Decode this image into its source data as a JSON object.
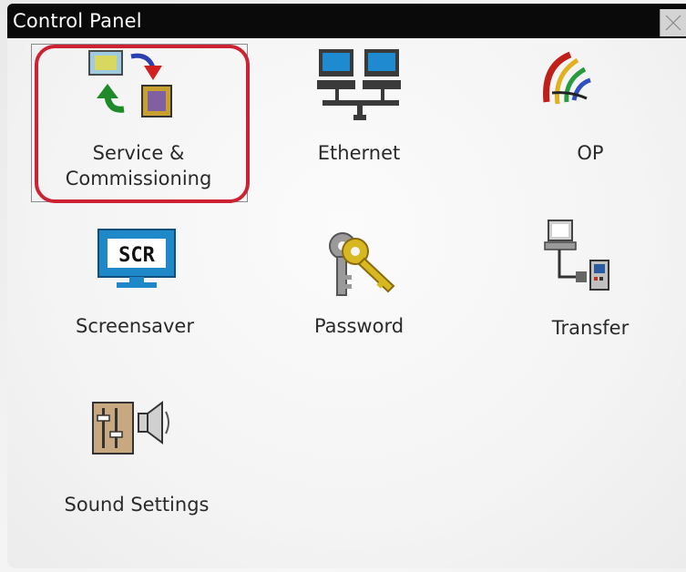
{
  "window": {
    "title": "Control Panel"
  },
  "items": [
    {
      "label_line1": "Service &",
      "label_line2": "Commissioning",
      "icon": "service-commissioning-icon",
      "selected": true
    },
    {
      "label": "Ethernet",
      "icon": "network-computers-icon"
    },
    {
      "label": "OP",
      "icon": "op-swirl-icon"
    },
    {
      "label": "Screensaver",
      "icon": "monitor-scr-icon",
      "icon_text": "SCR"
    },
    {
      "label": "Password",
      "icon": "keys-icon"
    },
    {
      "label": "Transfer",
      "icon": "transfer-devices-icon"
    },
    {
      "label": "Sound Settings",
      "icon": "sound-mixer-icon"
    }
  ],
  "colors": {
    "titlebar": "#0a0a0a",
    "annotation": "#cc2233",
    "text": "#2a2a2a"
  }
}
